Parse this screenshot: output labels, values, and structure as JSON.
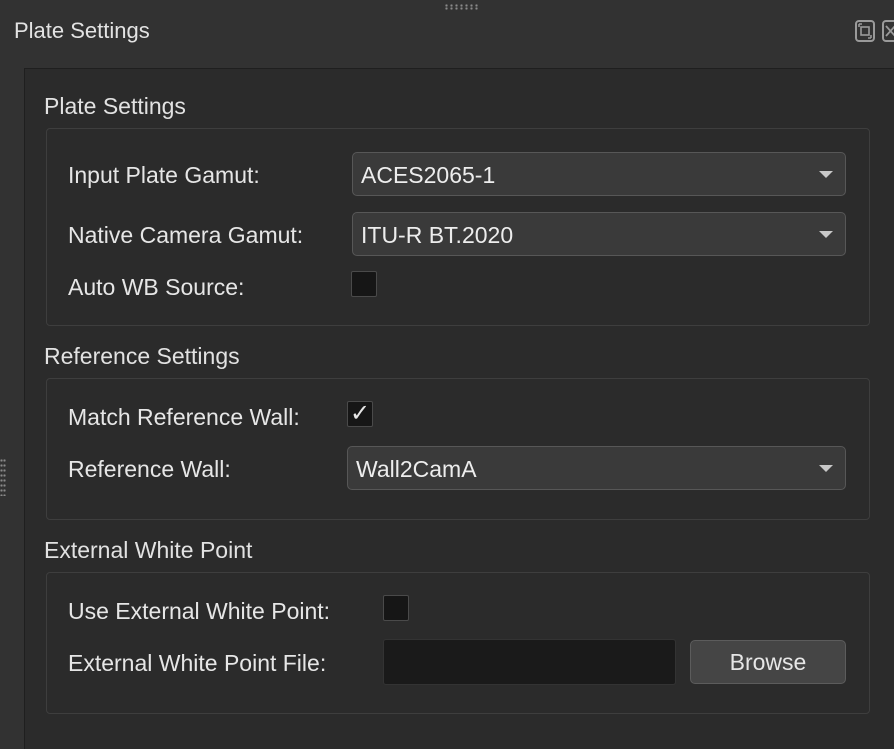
{
  "dock": {
    "title": "Plate Settings",
    "float_icon": "float-window-icon",
    "close_icon": "close-icon"
  },
  "plate_settings": {
    "title": "Plate Settings",
    "input_plate_gamut": {
      "label": "Input Plate Gamut:",
      "value": "ACES2065-1"
    },
    "native_camera_gamut": {
      "label": "Native Camera Gamut:",
      "value": "ITU-R BT.2020"
    },
    "auto_wb_source": {
      "label": "Auto WB Source:",
      "checked": false
    }
  },
  "reference_settings": {
    "title": "Reference Settings",
    "match_reference_wall": {
      "label": "Match Reference Wall:",
      "checked": true,
      "mark": "✓"
    },
    "reference_wall": {
      "label": "Reference Wall:",
      "value": "Wall2CamA"
    }
  },
  "external_white_point": {
    "title": "External White Point",
    "use_external_white_point": {
      "label": "Use External White Point:",
      "checked": false
    },
    "external_white_point_file": {
      "label": "External White Point File:",
      "value": ""
    },
    "browse_label": "Browse"
  },
  "colors": {
    "background": "#323232",
    "panel": "#2b2b2b",
    "text": "#e6e6e6"
  }
}
